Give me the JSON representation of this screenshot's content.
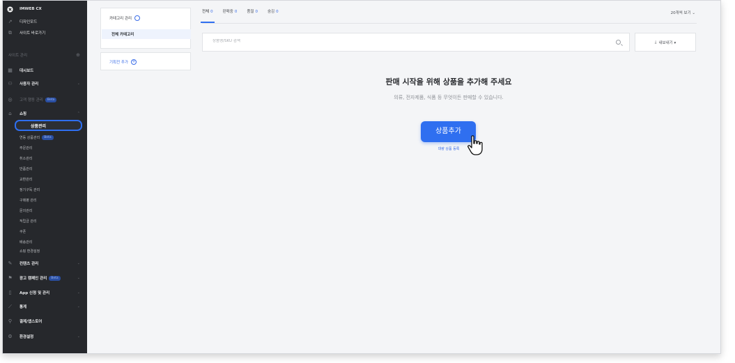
{
  "sidebar": {
    "brand": "IMWEB CX",
    "top_links": [
      "디자인모드",
      "사이트 바로가기"
    ],
    "section_label": "사이트 관리",
    "items": [
      {
        "label": "대시보드",
        "icon": "grid-icon"
      },
      {
        "label": "사용자 관리",
        "icon": "user-icon",
        "chevron": "⌄"
      },
      {
        "label": "고객 행동 관리",
        "badge": "Beta",
        "icon": "target-icon",
        "dim": true
      },
      {
        "label": "쇼핑",
        "icon": "bag-icon",
        "chevron": "⌃"
      }
    ],
    "shop_sub": [
      "상품관리",
      "연동 상품관리",
      "주문관리",
      "취소관리",
      "반품관리",
      "교환관리",
      "정기구독 관리",
      "구매평 관리",
      "문의관리",
      "적립금 관리",
      "쿠폰",
      "배송관리",
      "쇼핑 환경설정"
    ],
    "shop_sub_badge": "Beta",
    "bottom_items": [
      {
        "label": "컨텐츠 관리",
        "icon": "edit-icon",
        "chevron": "⌄"
      },
      {
        "label": "광고 캠페인 관리",
        "badge": "Beta",
        "icon": "megaphone-icon",
        "chevron": "⌄"
      },
      {
        "label": "App 신청 및 관리",
        "icon": "mobile-icon",
        "chevron": "⌄"
      },
      {
        "label": "통계",
        "icon": "chart-icon",
        "chevron": "⌄"
      },
      {
        "label": "결제/앱스토어",
        "icon": "plug-icon"
      },
      {
        "label": "환경설정",
        "icon": "gear-icon",
        "chevron": "⌄"
      }
    ]
  },
  "category": {
    "manage_label": "카테고리 관리",
    "all_label": "전체 카테고리",
    "plan_label": "기획전 추가"
  },
  "tabs": [
    {
      "label": "전체",
      "count": "0"
    },
    {
      "label": "판매중",
      "count": "0"
    },
    {
      "label": "품절",
      "count": "0"
    },
    {
      "label": "숨김",
      "count": "0"
    }
  ],
  "view_select": "20개씩 보기 ⌄",
  "search": {
    "placeholder": "상품명/SKU 검색"
  },
  "export_label": "내보내기 ▾",
  "empty": {
    "title": "판매 시작을 위해 상품을 추가해 주세요",
    "subtitle": "의류, 전자제품, 식품 등 무엇이든 판매할 수 있습니다.",
    "add_button": "상품추가",
    "bulk_link": "대량 상품 등록"
  },
  "colors": {
    "accent": "#2f6ff0",
    "sidebar_bg": "#26282c"
  }
}
